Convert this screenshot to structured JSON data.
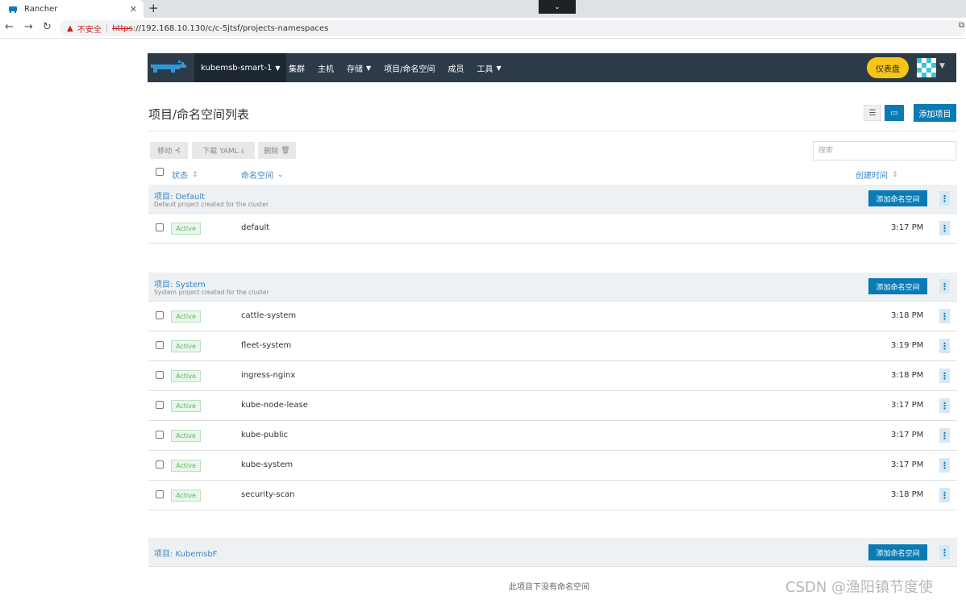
{
  "browser": {
    "tab_title": "Rancher",
    "tab_close": "✕",
    "new_tab": "+",
    "tab_search": "⌄",
    "back": "←",
    "forward": "→",
    "reload": "↻",
    "insecure": "不安全",
    "url_scheme": "https",
    "url_rest": "://192.168.10.130/c/c-5jtsf/projects-namespaces"
  },
  "header": {
    "cluster": "kubemsb-smart-1",
    "menu": [
      "集群",
      "主机",
      "存储",
      "项目/命名空间",
      "成员",
      "工具"
    ],
    "dashboard": "仪表盘"
  },
  "page": {
    "title": "项目/命名空间列表",
    "add_project": "添加项目"
  },
  "toolbar": {
    "move": "移动",
    "download_yaml": "下载 YAML",
    "delete": "删除",
    "search_placeholder": "搜索"
  },
  "columns": {
    "state": "状态",
    "namespace": "命名空间",
    "created": "创建时间"
  },
  "add_namespace": "添加命名空间",
  "groups": [
    {
      "name": "项目: Default",
      "desc": "Default project created for the cluster",
      "rows": [
        {
          "state": "Active",
          "name": "default",
          "time": "3:17 PM"
        }
      ]
    },
    {
      "name": "项目: System",
      "desc": "System project created for the cluster",
      "rows": [
        {
          "state": "Active",
          "name": "cattle-system",
          "time": "3:18 PM"
        },
        {
          "state": "Active",
          "name": "fleet-system",
          "time": "3:19 PM"
        },
        {
          "state": "Active",
          "name": "ingress-nginx",
          "time": "3:18 PM"
        },
        {
          "state": "Active",
          "name": "kube-node-lease",
          "time": "3:17 PM"
        },
        {
          "state": "Active",
          "name": "kube-public",
          "time": "3:17 PM"
        },
        {
          "state": "Active",
          "name": "kube-system",
          "time": "3:17 PM"
        },
        {
          "state": "Active",
          "name": "security-scan",
          "time": "3:18 PM"
        }
      ]
    },
    {
      "name": "项目: KubemsbF",
      "desc": "",
      "rows": []
    }
  ],
  "empty_message": "此项目下没有命名空间",
  "watermark": "CSDN @渔阳镇节度使",
  "colors": {
    "header_bg": "#2d3a48",
    "accent_blue": "#0a7bb5",
    "dashboard_yellow": "#f5c518",
    "active_green": "#5cb85c"
  }
}
